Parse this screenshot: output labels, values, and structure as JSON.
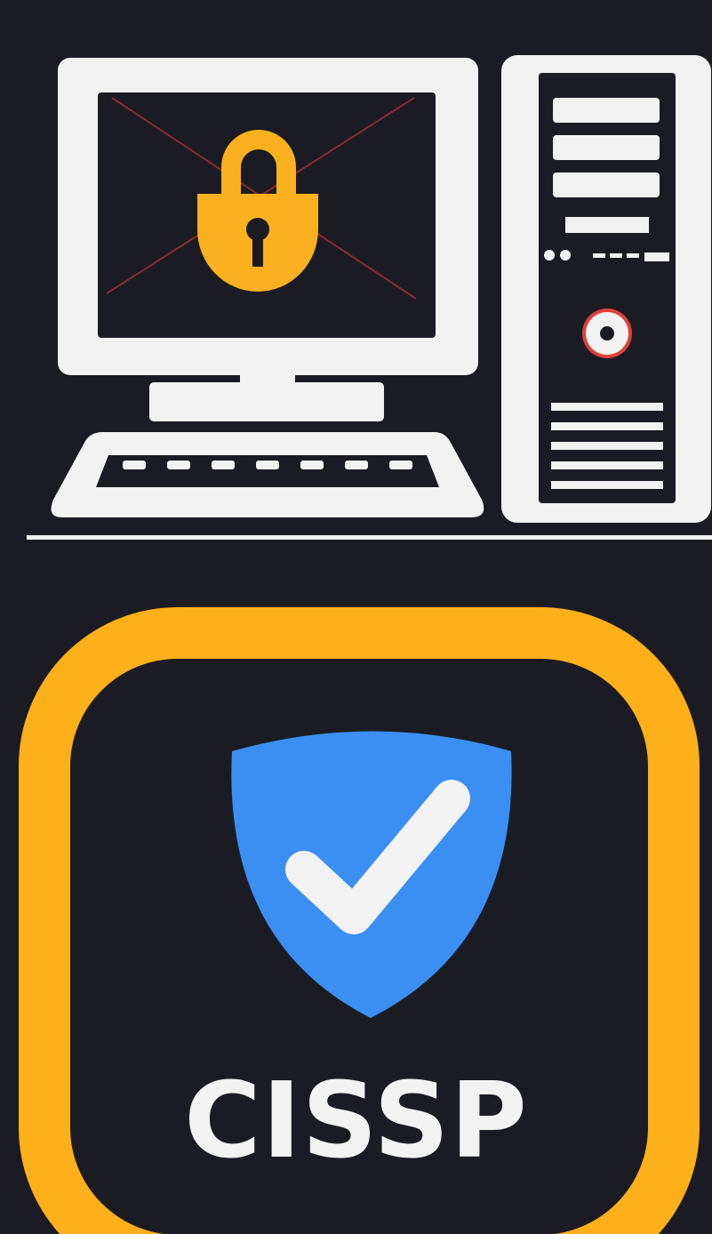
{
  "colors": {
    "background": "#1b1c23",
    "device_white": "#f2f2f2",
    "lock_gold": "#fbb11f",
    "screen_x_red": "#8a2b2f",
    "power_ring_red": "#e0403c",
    "badge_border_gold": "#fdb01a",
    "shield_blue": "#3b8ff2",
    "check_white": "#f2f2f2"
  },
  "icons": {
    "monitor": "monitor-icon",
    "padlock": "padlock-icon",
    "keyboard": "keyboard-icon",
    "tower": "pc-tower-icon",
    "power_button": "power-button-icon",
    "shield": "shield-check-icon"
  },
  "badge": {
    "label": "CISSP"
  }
}
